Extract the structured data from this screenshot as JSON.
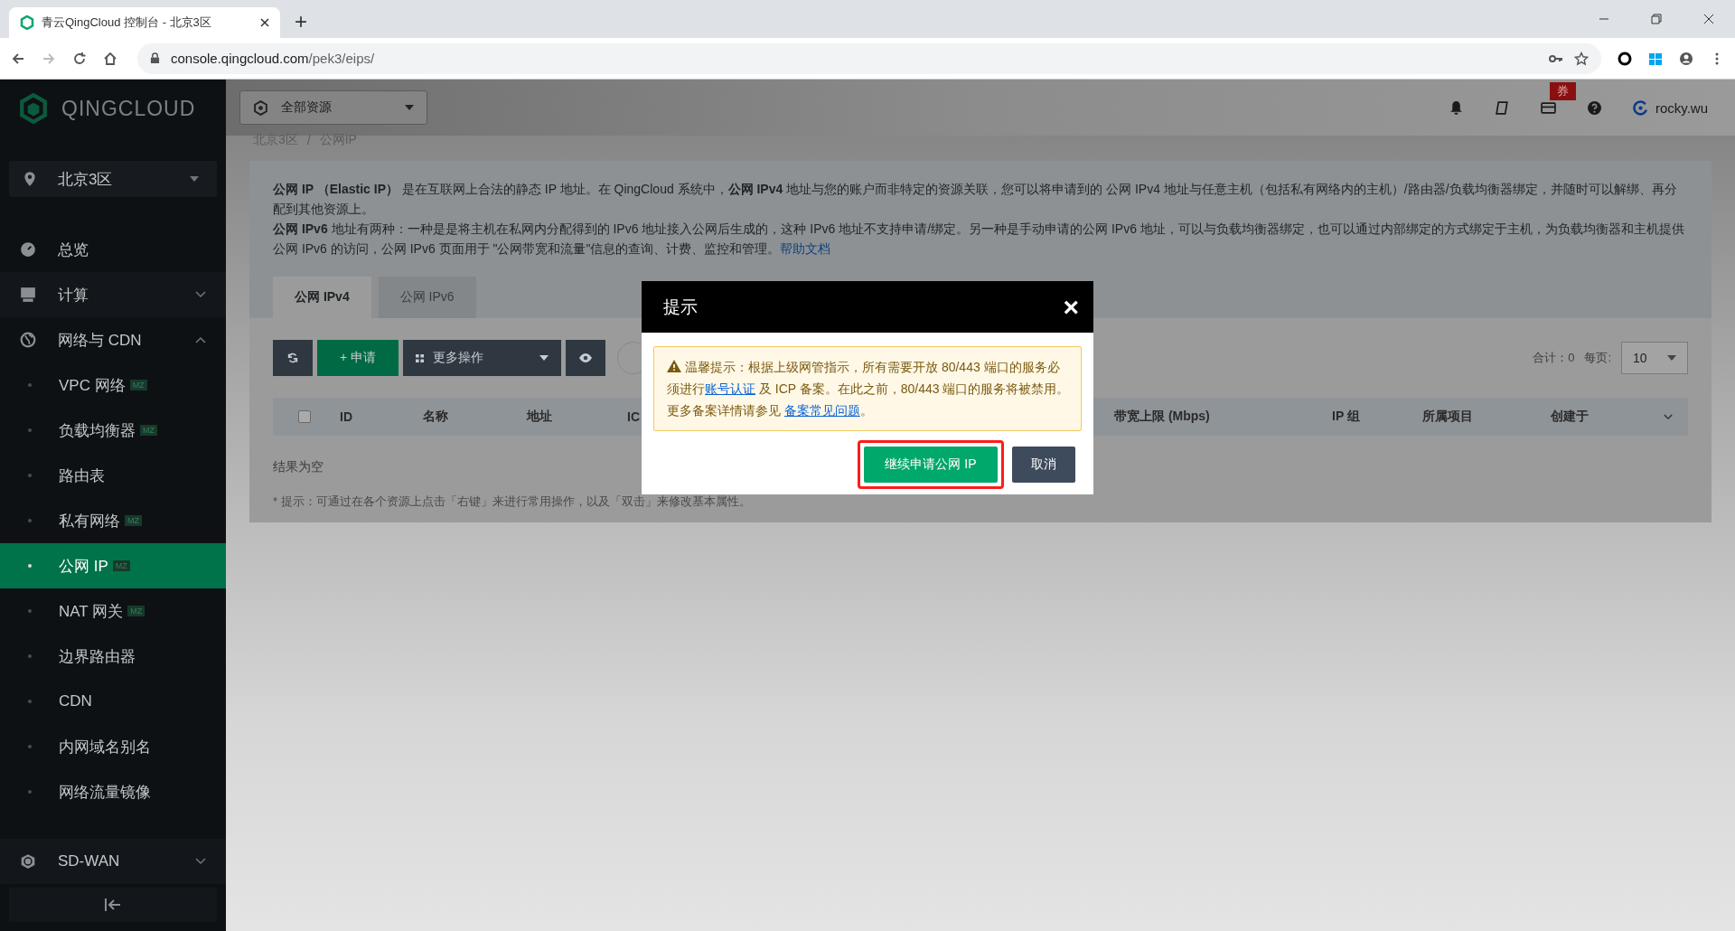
{
  "browser": {
    "tab_title": "青云QingCloud 控制台 - 北京3区",
    "new_tab": "+",
    "url_host": "console.qingcloud.com",
    "url_path": "/pek3/eips/"
  },
  "sidebar": {
    "logo": "QINGCLOUD",
    "region": "北京3区",
    "items": [
      {
        "label": "总览"
      },
      {
        "label": "计算",
        "expanded": false
      },
      {
        "label": "网络与 CDN",
        "expanded": true,
        "children": [
          {
            "label": "VPC 网络",
            "badge": "MZ",
            "selected": false
          },
          {
            "label": "负载均衡器",
            "badge": "MZ",
            "selected": false
          },
          {
            "label": "路由表",
            "selected": false
          },
          {
            "label": "私有网络",
            "badge": "MZ",
            "selected": false
          },
          {
            "label": "公网 IP",
            "badge": "MZ",
            "selected": true
          },
          {
            "label": "NAT 网关",
            "badge": "MZ",
            "selected": false
          },
          {
            "label": "边界路由器",
            "selected": false
          },
          {
            "label": "CDN",
            "selected": false
          },
          {
            "label": "内网域名别名",
            "selected": false
          },
          {
            "label": "网络流量镜像",
            "selected": false
          }
        ]
      }
    ],
    "bottom_item": {
      "label": "SD-WAN",
      "expanded": false
    }
  },
  "topbar": {
    "resource_select": "全部资源",
    "coupon_badge": "券",
    "user": "rocky.wu"
  },
  "breadcrumb": {
    "items": [
      "北京3区",
      "公网IP"
    ],
    "separator": "/"
  },
  "description": [
    "**公网 IP （Elastic IP）** 是在互联网上合法的静态 IP 地址。在 QingCloud 系统中，**公网 IPv4** 地址与您的账户而非特定的资源关联，您可以将申请到的 公网 IPv4 地址与任意主机（包括私有网络内的主机）/路由器/负载均衡器绑定，并随时可以解绑、再分配到其他资源上。",
    "**公网 IPv6** 地址有两种：一种是是将主机在私网内分配得到的 IPv6 地址接入公网后生成的，这种 IPv6 地址不支持申请/绑定。另一种是手动申请的公网 IPv6 地址，可以与负载均衡器绑定，也可以通过内部绑定的方式绑定于主机，为负载均衡器和主机提供公网 IPv6 的访问，公网 IPv6 页面用于 \"公网带宽和流量\"信息的查询、计费、监控和管理。"
  ],
  "help_link": "帮助文档",
  "tabs": [
    {
      "label": "公网 IPv4",
      "selected": true
    },
    {
      "label": "公网 IPv6",
      "selected": false
    }
  ],
  "toolbar": {
    "apply": "+ 申请",
    "more": "更多操作",
    "total": "合计：0",
    "per_page_label": "每页:",
    "per_page": "10"
  },
  "table": {
    "select_all_checked": false,
    "columns": [
      "ID",
      "名称",
      "地址",
      "IC",
      "带宽上限 (Mbps)",
      "IP 组",
      "所属项目",
      "创建于"
    ],
    "empty": "结果为空"
  },
  "hint": "* 提示：可通过在各个资源上点击「右键」来进行常用操作，以及「双击」来修改基本属性。",
  "dialog": {
    "title": "提示",
    "close": "×",
    "message": [
      {
        "kind": "text",
        "text": "温馨提示：根据上级网管指示，所有需要开放 80/443 端口的服务必须进行"
      },
      {
        "kind": "link",
        "text": "账号认证"
      },
      {
        "kind": "text",
        "text": " 及 ICP 备案。在此之前，80/443 端口的服务将被禁用。更多备案详情请参见 "
      },
      {
        "kind": "link",
        "text": "备案常见问题"
      },
      {
        "kind": "text",
        "text": "。"
      }
    ],
    "buttons": [
      {
        "label": "继续申请公网 IP",
        "kind": "primary",
        "highlighted": true
      },
      {
        "label": "取消",
        "kind": "secondary",
        "highlighted": false
      }
    ]
  }
}
